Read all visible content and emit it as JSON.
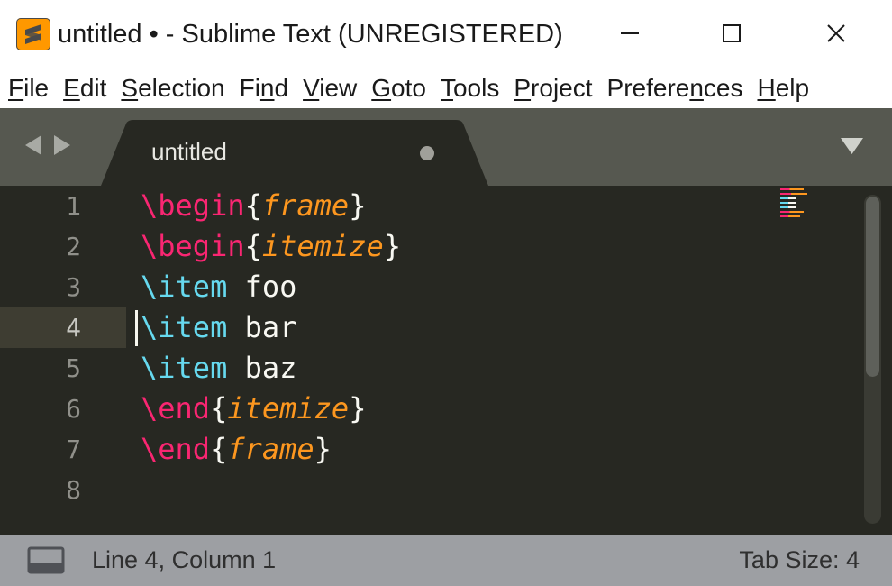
{
  "window": {
    "title": "untitled • - Sublime Text (UNREGISTERED)",
    "logo_letter_icon": "sublime-s-logo",
    "controls": [
      "minimize-icon",
      "maximize-icon",
      "close-icon"
    ]
  },
  "menu": {
    "items": [
      {
        "pre": "",
        "u": "F",
        "post": "ile"
      },
      {
        "pre": "",
        "u": "E",
        "post": "dit"
      },
      {
        "pre": "",
        "u": "S",
        "post": "election"
      },
      {
        "pre": "Fi",
        "u": "n",
        "post": "d"
      },
      {
        "pre": "",
        "u": "V",
        "post": "iew"
      },
      {
        "pre": "",
        "u": "G",
        "post": "oto"
      },
      {
        "pre": "",
        "u": "T",
        "post": "ools"
      },
      {
        "pre": "",
        "u": "P",
        "post": "roject"
      },
      {
        "pre": "Prefere",
        "u": "n",
        "post": "ces"
      },
      {
        "pre": "",
        "u": "H",
        "post": "elp"
      }
    ]
  },
  "tabs": {
    "active": {
      "label": "untitled",
      "dirty": true
    }
  },
  "editor": {
    "line_numbers": [
      "1",
      "2",
      "3",
      "4",
      "5",
      "6",
      "7",
      "8"
    ],
    "current_line": 4,
    "lines": [
      {
        "cmd": "\\begin",
        "cmd_color": "red",
        "arg": "frame",
        "rest": ""
      },
      {
        "cmd": "\\begin",
        "cmd_color": "red",
        "arg": "itemize",
        "rest": ""
      },
      {
        "cmd": "\\item",
        "cmd_color": "cyan",
        "arg": null,
        "rest": " foo"
      },
      {
        "cmd": "\\item",
        "cmd_color": "cyan",
        "arg": null,
        "rest": " bar"
      },
      {
        "cmd": "\\item",
        "cmd_color": "cyan",
        "arg": null,
        "rest": " baz"
      },
      {
        "cmd": "\\end",
        "cmd_color": "red",
        "arg": "itemize",
        "rest": ""
      },
      {
        "cmd": "\\end",
        "cmd_color": "red",
        "arg": "frame",
        "rest": ""
      },
      {
        "cmd": "",
        "cmd_color": "",
        "arg": null,
        "rest": ""
      }
    ],
    "colors": {
      "background": "#272822",
      "keyword_red": "#f92672",
      "keyword_cyan": "#66d9ef",
      "argument_orange": "#fd971f",
      "text": "#f8f8f2"
    }
  },
  "statusbar": {
    "panel_icon": "panel-toggle-icon",
    "position": "Line 4, Column 1",
    "tab_size": "Tab Size: 4"
  }
}
